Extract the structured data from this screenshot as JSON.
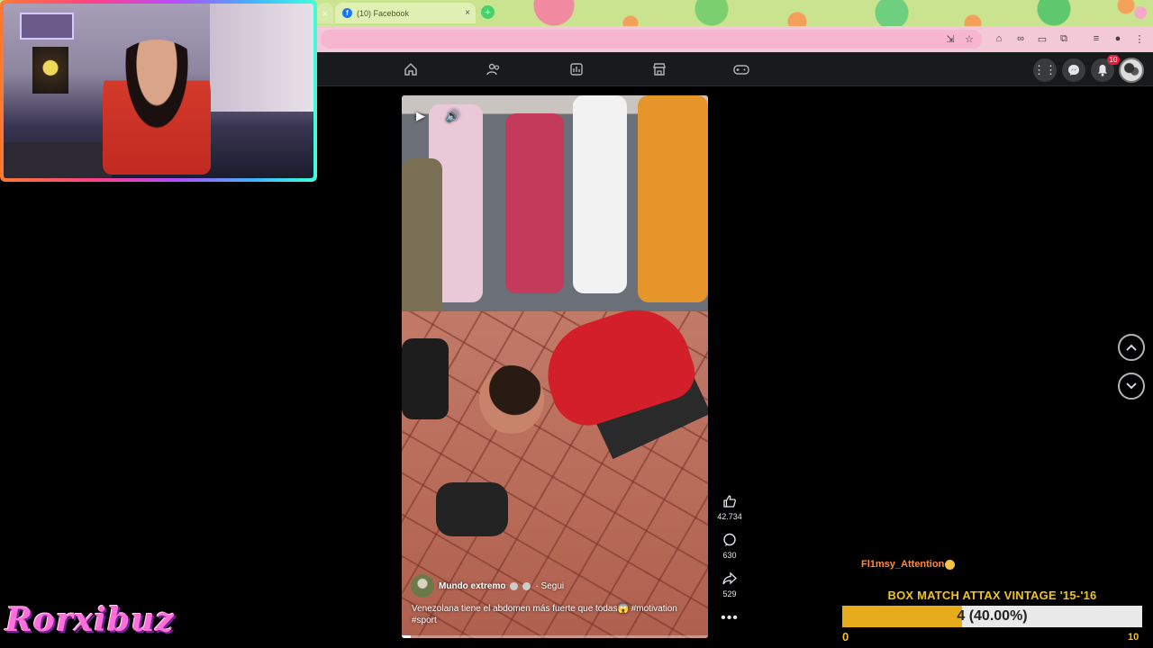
{
  "browser": {
    "tab_title": "(10) Facebook",
    "tab_close": "×",
    "new_tab": "+",
    "small_tab_close": "×"
  },
  "fbnav": {
    "icons": [
      "home-icon",
      "friends-icon",
      "dashboard-icon",
      "marketplace-icon",
      "gaming-icon"
    ],
    "notification_count": "10"
  },
  "video": {
    "author": "Mundo extremo",
    "follow": "· Segui",
    "caption": "Venezolana tiene el abdomen más fuerte que todas😱 #motivation #sport",
    "progress": 0.03
  },
  "actions": {
    "likes": "42.734",
    "comments": "630",
    "shares": "529"
  },
  "overlay": {
    "watermark": "Rorxibuz",
    "chat_user": "Fl1msy_Attention",
    "poll": {
      "title": "BOX MATCH ATTAX VINTAGE '15-'16",
      "value_text": "4 (40.00%)",
      "fraction": 0.4,
      "min": "0",
      "max": "10"
    }
  },
  "colors": {
    "facebook_blue": "#1877f2",
    "poll_fill": "#e6ac1c",
    "poll_text": "#f0c419",
    "watermark": "#ff6fd8",
    "chat_user": "#ff8a3d",
    "notification": "#e41e3f"
  }
}
